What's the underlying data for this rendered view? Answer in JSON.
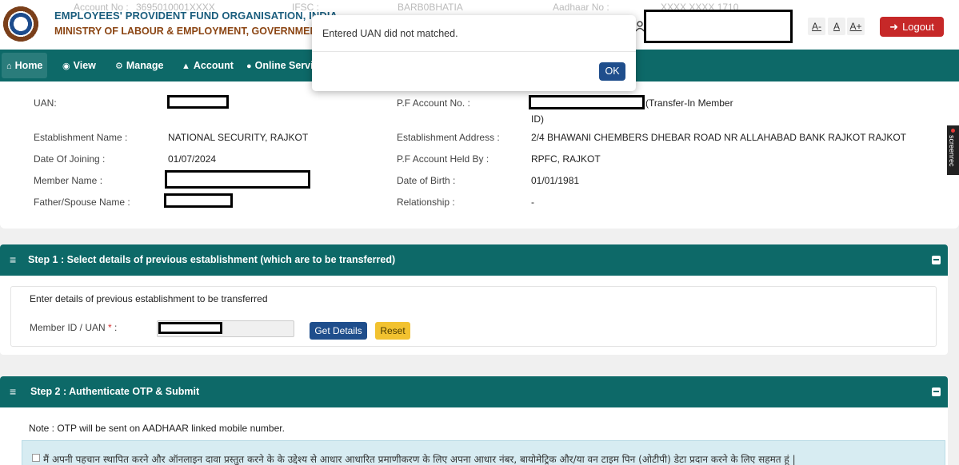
{
  "header": {
    "org_title": "EMPLOYEES' PROVIDENT FUND ORGANISATION, INDIA",
    "ministry": "MINISTRY OF LABOUR & EMPLOYMENT, GOVERNMENT OF INDIA",
    "account_no_label": "Account No :",
    "account_no_value": "3695010001XXXX",
    "ifsc_label": "IFSC :",
    "ifsc_value": "BARB0BHATIA",
    "aadhaar_label": "Aadhaar No :",
    "aadhaar_value": "XXXX XXXX 1710",
    "font_decrease": "A-",
    "font_normal": "A",
    "font_increase": "A+",
    "logout_label": "Logout"
  },
  "nav": {
    "items": [
      {
        "label": "Home",
        "icon": "home-icon"
      },
      {
        "label": "View",
        "icon": "eye-icon"
      },
      {
        "label": "Manage",
        "icon": "cogs-icon"
      },
      {
        "label": "Account",
        "icon": "user-icon"
      },
      {
        "label": "Online Services",
        "icon": "globe-icon"
      }
    ]
  },
  "member": {
    "uan_label": "UAN:",
    "establishment_name_label": "Establishment Name :",
    "establishment_name_value": "NATIONAL SECURITY, RAJKOT",
    "date_of_joining_label": "Date Of Joining :",
    "date_of_joining_value": "01/07/2024",
    "member_name_label": "Member Name :",
    "father_spouse_label": "Father/Spouse Name :",
    "pf_account_label": "P.F Account No. :",
    "pf_account_suffix": "(Transfer-In Member",
    "pf_account_suffix2": "ID)",
    "establishment_address_label": "Establishment Address :",
    "establishment_address_value": "2/4 BHAWANI CHEMBERS DHEBAR ROAD NR ALLAHABAD BANK RAJKOT RAJKOT",
    "pf_held_by_label": "P.F Account Held By :",
    "pf_held_by_value": "RPFC, RAJKOT",
    "dob_label": "Date of Birth :",
    "dob_value": "01/01/1981",
    "relationship_label": "Relationship :",
    "relationship_value": "-"
  },
  "step1": {
    "title": "Step 1 : Select details of previous establishment (which are to be transferred)",
    "subtitle": "Enter details of previous establishment to be transferred",
    "member_id_label": "Member ID / UAN",
    "required_mark": "*",
    "colon": ":",
    "get_details_label": "Get Details",
    "reset_label": "Reset"
  },
  "step2": {
    "title": "Step 2 : Authenticate OTP & Submit",
    "note": "Note : OTP will be sent on AADHAAR linked mobile number.",
    "consent_text": "मैं अपनी पहचान स्थापित करने और ऑनलाइन दावा प्रस्तुत करने के के उद्देश्य से आधार आधारित प्रमाणीकरण के लिए अपना आधार नंबर, बायोमेट्रिक और/या वन टाइम पिन (ओटीपी) डेटा प्रदान करने के लिए सहमत हूं |"
  },
  "modal": {
    "message": "Entered UAN did not matched.",
    "ok_label": "OK"
  },
  "screenrec": {
    "label": "screenrec"
  }
}
